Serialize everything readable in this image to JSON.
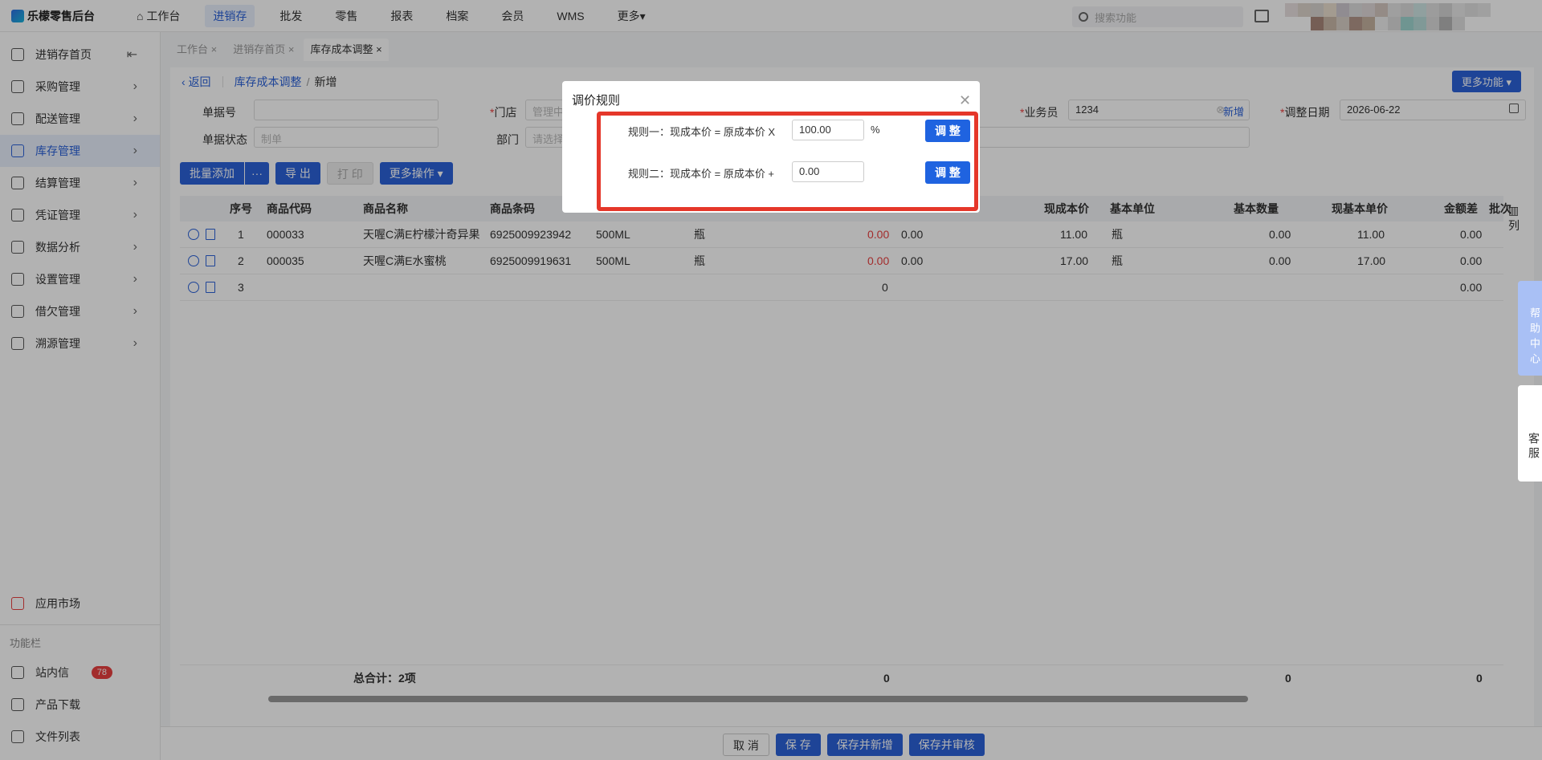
{
  "app": {
    "title": "乐檬零售后台"
  },
  "nav": [
    "工作台",
    "进销存",
    "批发",
    "零售",
    "报表",
    "档案",
    "会员",
    "WMS",
    "更多"
  ],
  "search": {
    "placeholder": "搜索功能"
  },
  "sidebar": {
    "items": [
      "进销存首页",
      "采购管理",
      "配送管理",
      "库存管理",
      "结算管理",
      "凭证管理",
      "数据分析",
      "设置管理",
      "借欠管理",
      "溯源管理"
    ],
    "market": "应用市场",
    "func_title": "功能栏",
    "func": [
      "站内信",
      "产品下载",
      "文件列表"
    ],
    "badge": "78"
  },
  "tabs": [
    "工作台",
    "进销存首页",
    "库存成本调整"
  ],
  "breadcrumb": {
    "back": "返回",
    "parent": "库存成本调整",
    "current": "新增"
  },
  "more_functions": "更多功能",
  "form": {
    "doc_no_label": "单据号",
    "doc_status_label": "单据状态",
    "doc_status_placeholder": "制单",
    "store_label": "门店",
    "store_placeholder": "管理中",
    "dept_label": "部门",
    "dept_placeholder": "请选择",
    "salesman_label": "业务员",
    "salesman_value": "1234",
    "add_label": "新增",
    "date_label": "调整日期",
    "date_value": "2026-06-22"
  },
  "toolbar": {
    "batch_add": "批量添加",
    "more_dots": "···",
    "export": "导 出",
    "print": "打 印",
    "more_ops": "更多操作"
  },
  "table": {
    "headers": {
      "no": "序号",
      "code": "商品代码",
      "name": "商品名称",
      "barcode": "商品条码",
      "cur_cost": "现成本价",
      "base_unit": "基本单位",
      "base_qty": "基本数量",
      "cur_base_price": "现基本单价",
      "amount_diff": "金额差",
      "batch": "批次",
      "cols": "列"
    },
    "rows": [
      {
        "no": "1",
        "code": "000033",
        "name": "天喔C满E柠檬汁奇异果",
        "barcode": "6925009923942",
        "spec": "500ML",
        "unit": "瓶",
        "c1": "0.00",
        "c2": "0.00",
        "cost": "11.00",
        "bunit": "瓶",
        "bqty": "0.00",
        "bprice": "11.00",
        "diff": "0.00"
      },
      {
        "no": "2",
        "code": "000035",
        "name": "天喔C满E水蜜桃",
        "barcode": "6925009919631",
        "spec": "500ML",
        "unit": "瓶",
        "c1": "0.00",
        "c2": "0.00",
        "cost": "17.00",
        "bunit": "瓶",
        "bqty": "0.00",
        "bprice": "17.00",
        "diff": "0.00"
      },
      {
        "no": "3",
        "c1": "0",
        "diff": "0.00"
      }
    ],
    "summary": {
      "label": "总合计：2项",
      "v1": "0",
      "v2": "0",
      "v3": "0"
    }
  },
  "footer": {
    "cancel": "取 消",
    "save": "保 存",
    "save_new": "保存并新增",
    "save_audit": "保存并审核"
  },
  "side_tools": {
    "help": "帮助中心",
    "service": "客服"
  },
  "modal": {
    "title": "调价规则",
    "rule1_text": "规则一：现成本价 = 原成本价 X",
    "rule1_value": "100.00",
    "rule1_unit": "%",
    "rule2_text": "规则二：现成本价 = 原成本价 +",
    "rule2_value": "0.00",
    "adjust": "调 整"
  }
}
